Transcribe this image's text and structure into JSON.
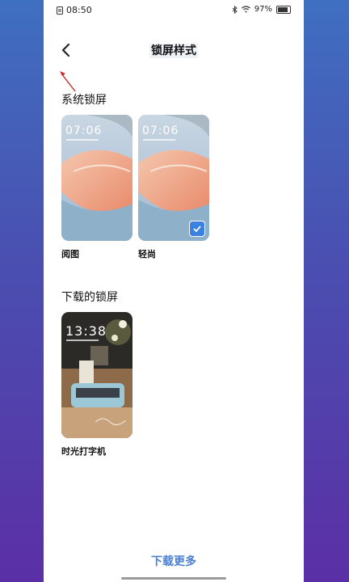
{
  "status_bar": {
    "time": "08:50",
    "battery": "97%"
  },
  "header": {
    "title": "锁屏样式"
  },
  "system_section": {
    "title": "系统锁屏",
    "items": [
      {
        "label": "阅图",
        "lock_time": "07:06",
        "selected": false
      },
      {
        "label": "轻尚",
        "lock_time": "07:06",
        "selected": true
      }
    ]
  },
  "downloaded_section": {
    "title": "下载的锁屏",
    "items": [
      {
        "label": "时光打字机",
        "lock_time": "13:38",
        "selected": false
      }
    ]
  },
  "footer": {
    "more_label": "下载更多"
  },
  "colors": {
    "accent": "#4a7fd1",
    "check": "#3b82e0"
  }
}
